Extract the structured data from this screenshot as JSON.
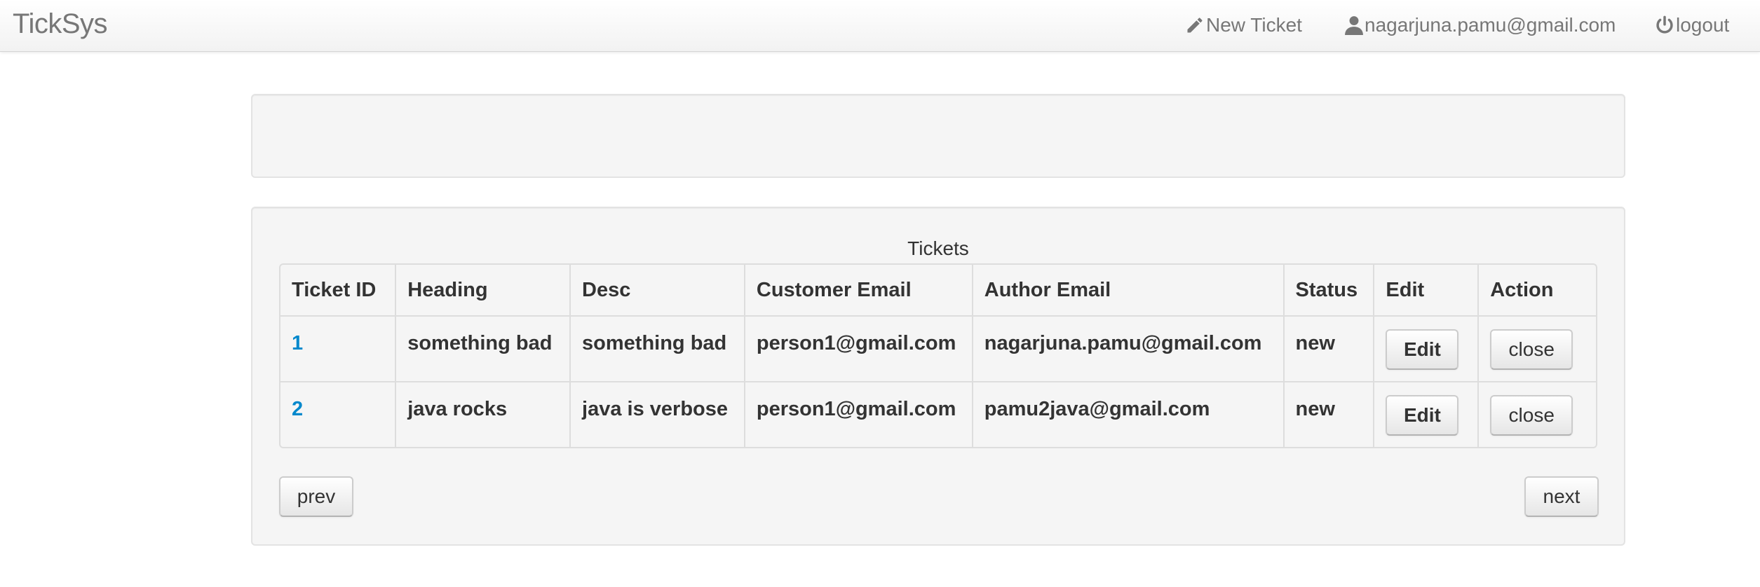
{
  "navbar": {
    "brand": "TickSys",
    "new_ticket_label": "New Ticket",
    "user_email": "nagarjuna.pamu@gmail.com",
    "logout_label": "logout"
  },
  "tickets": {
    "caption": "Tickets",
    "columns": [
      "Ticket ID",
      "Heading",
      "Desc",
      "Customer Email",
      "Author Email",
      "Status",
      "Edit",
      "Action"
    ],
    "rows": [
      {
        "id": "1",
        "heading": "something bad",
        "desc": "something bad",
        "customer_email": "person1@gmail.com",
        "author_email": "nagarjuna.pamu@gmail.com",
        "status": "new",
        "edit_label": "Edit",
        "action_label": "close"
      },
      {
        "id": "2",
        "heading": "java rocks",
        "desc": "java is verbose",
        "customer_email": "person1@gmail.com",
        "author_email": "pamu2java@gmail.com",
        "status": "new",
        "edit_label": "Edit",
        "action_label": "close"
      }
    ]
  },
  "pagination": {
    "prev_label": "prev",
    "next_label": "next"
  },
  "colors": {
    "link": "#0088cc",
    "nav_text": "#777777",
    "well_bg": "#f5f5f5",
    "text": "#333333"
  },
  "icons": {
    "new_ticket": "pencil-icon",
    "user": "user-icon",
    "logout": "power-icon"
  }
}
